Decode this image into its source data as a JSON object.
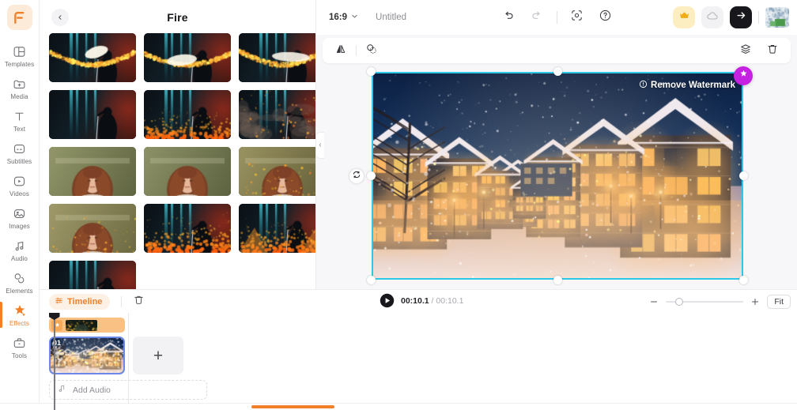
{
  "app": {
    "brand_icon": "flexclip-logo-icon",
    "accent": "#f0802a",
    "selection_color": "#2cc8e8",
    "clip_selection_color": "#6c88e8"
  },
  "sidebar": {
    "items": [
      {
        "label": "Templates",
        "icon": "templates-icon",
        "active": false
      },
      {
        "label": "Media",
        "icon": "media-folder-plus-icon",
        "active": false
      },
      {
        "label": "Text",
        "icon": "text-icon",
        "active": false
      },
      {
        "label": "Subtitles",
        "icon": "subtitles-icon",
        "active": false
      },
      {
        "label": "Videos",
        "icon": "videos-play-icon",
        "active": false
      },
      {
        "label": "Images",
        "icon": "images-icon",
        "active": false
      },
      {
        "label": "Audio",
        "icon": "audio-note-icon",
        "active": false
      },
      {
        "label": "Elements",
        "icon": "elements-shapes-icon",
        "active": false
      },
      {
        "label": "Effects",
        "icon": "effects-sparkle-icon",
        "active": true
      },
      {
        "label": "Tools",
        "icon": "tools-briefcase-icon",
        "active": false
      }
    ]
  },
  "panel": {
    "title": "Fire",
    "back_icon": "chevron-left-icon",
    "collapse_icon": "chevron-left-icon",
    "thumbnails": [
      {
        "name": "fire-effect-1",
        "style": "firearc-bright"
      },
      {
        "name": "fire-effect-2",
        "style": "firearc-left"
      },
      {
        "name": "fire-effect-3",
        "style": "firearc-wide"
      },
      {
        "name": "fire-effect-4",
        "style": "dark-stage"
      },
      {
        "name": "fire-effect-5",
        "style": "flames-bottom"
      },
      {
        "name": "fire-effect-6",
        "style": "smoke-embers"
      },
      {
        "name": "fire-effect-7",
        "style": "portrait-green"
      },
      {
        "name": "fire-effect-8",
        "style": "portrait-teal"
      },
      {
        "name": "fire-effect-9",
        "style": "portrait-embers"
      },
      {
        "name": "fire-effect-10",
        "style": "portrait-golden"
      },
      {
        "name": "fire-effect-11",
        "style": "flames-big"
      },
      {
        "name": "fire-effect-12",
        "style": "flames-orange"
      },
      {
        "name": "fire-effect-13",
        "style": "dark-stage-2"
      }
    ]
  },
  "topbar": {
    "aspect_ratio": "16:9",
    "aspect_ratio_caret": "chevron-down-icon",
    "project_title": "Untitled",
    "undo_icon": "undo-icon",
    "redo_icon": "redo-icon",
    "record_icon": "screen-record-icon",
    "help_icon": "help-circle-icon",
    "crown_icon": "crown-icon",
    "cloud_icon": "cloud-save-icon",
    "export_icon": "arrow-right-export-icon",
    "avatar_icon": "user-avatar"
  },
  "context_toolbar": {
    "flip_icon": "flip-horizontal-icon",
    "mask_icon": "mask-overlap-icon",
    "layers_icon": "layers-icon",
    "delete_icon": "trash-icon"
  },
  "canvas": {
    "watermark_label": "Remove Watermark",
    "watermark_info_icon": "info-circle-icon",
    "magic_icon": "magic-wand-icon",
    "rotate_icon": "rotate-icon",
    "handles": [
      "top-left",
      "top-center",
      "top-right",
      "middle-left",
      "middle-right",
      "bottom-left",
      "bottom-center",
      "bottom-right"
    ]
  },
  "timeline": {
    "chip_label": "Timeline",
    "chip_icon": "timeline-icon",
    "trash_icon": "trash-icon",
    "play_icon": "play-button-icon",
    "current_time": "00:10.1",
    "total_time": "00:10.1",
    "time_separator": " / ",
    "zoom_out_icon": "minus-icon",
    "zoom_in_icon": "plus-icon",
    "fit_label": "Fit",
    "zoom_value": 12,
    "effects_track": {
      "name": "fire-effect-applied",
      "badge_icon": "effect-badge-icon"
    },
    "video_clip": {
      "index_label": "01",
      "name": "winter-street-clip"
    },
    "add_clip_label": "+",
    "add_audio_label": "Add Audio",
    "add_audio_icon": "music-note-icon"
  }
}
